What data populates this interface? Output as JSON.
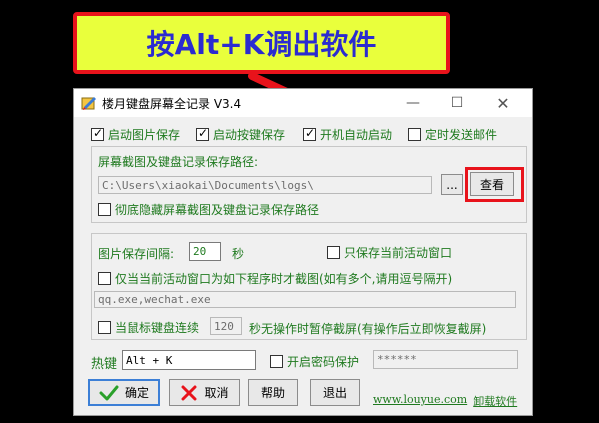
{
  "annotation": {
    "banner_text": "按Alt+K调出软件"
  },
  "window": {
    "title": "楼月键盘屏幕全记录 V3.4",
    "controls": {
      "minimize": "—",
      "maximize": "☐",
      "close": "✕"
    }
  },
  "options": {
    "start_image_save": {
      "label": "启动图片保存",
      "checked": true
    },
    "start_key_save": {
      "label": "启动按键保存",
      "checked": true
    },
    "auto_start": {
      "label": "开机自动启动",
      "checked": true
    },
    "timed_mail": {
      "label": "定时发送邮件",
      "checked": false
    }
  },
  "save_path": {
    "label": "屏幕截图及键盘记录保存路径:",
    "value": "C:\\Users\\xiaokai\\Documents\\logs\\",
    "browse_button": "...",
    "view_button": "查看",
    "hide_path": {
      "label": "彻底隐藏屏幕截图及键盘记录保存路径",
      "checked": false
    }
  },
  "screenshot": {
    "interval_label": "图片保存间隔:",
    "interval_value": "20",
    "interval_unit": "秒",
    "only_active_window": {
      "label": "只保存当前活动窗口",
      "checked": false
    },
    "only_programs": {
      "label": "仅当当前活动窗口为如下程序时才截图(如有多个,请用逗号隔开)",
      "checked": false
    },
    "programs_value": "qq.exe,wechat.exe",
    "idle_pause": {
      "label": "当鼠标键盘连续",
      "checked": false
    },
    "idle_seconds": "120",
    "idle_suffix": "秒无操作时暂停截屏(有操作后立即恢复截屏)"
  },
  "hotkey": {
    "label": "热键",
    "value": "Alt + K",
    "password": {
      "label": "开启密码保护",
      "checked": false
    },
    "password_value": "******"
  },
  "buttons": {
    "ok": "确定",
    "cancel": "取消",
    "help": "帮助",
    "exit": "退出"
  },
  "links": {
    "website": "www.louyue.com",
    "uninstall": "卸载软件"
  },
  "colors": {
    "banner_bg": "#e9ff3c",
    "banner_border": "#e8131b",
    "banner_text": "#2b2bd0",
    "option_text": "#1f7a1f"
  }
}
